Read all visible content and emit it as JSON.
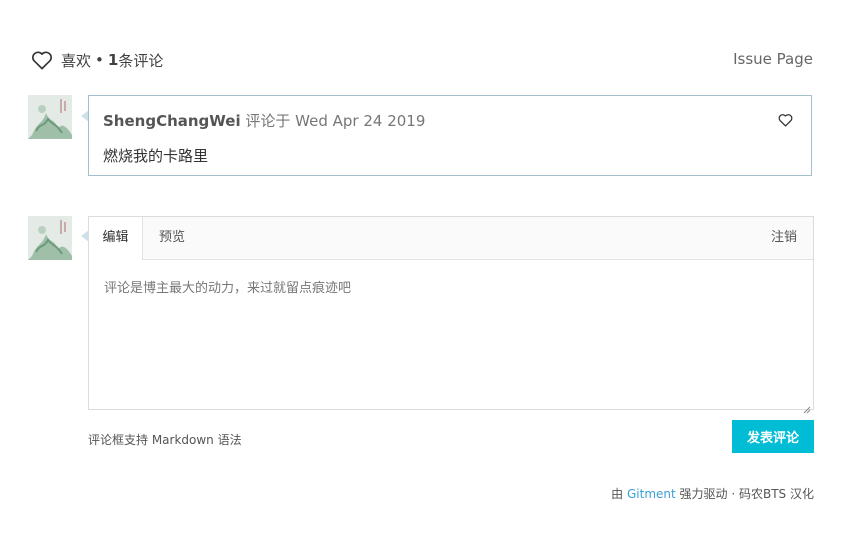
{
  "header": {
    "like_label": "喜欢",
    "separator": "•",
    "comment_count": "1",
    "comment_unit": "条评论",
    "issue_page": "Issue Page"
  },
  "comments": [
    {
      "author": "ShengChangWei",
      "meta": "评论于 Wed Apr 24 2019",
      "body": "燃烧我的卡路里"
    }
  ],
  "editor": {
    "tab_edit": "编辑",
    "tab_preview": "预览",
    "logout": "注销",
    "placeholder": "评论是博主最大的动力，来过就留点痕迹吧"
  },
  "hint": "评论框支持 Markdown 语法",
  "submit_label": "发表评论",
  "footer": {
    "prefix": "由",
    "link": "Gitment",
    "suffix": "强力驱动 · 码农BTS 汉化"
  },
  "colors": {
    "accent": "#00bcd4",
    "link": "#3a9fd6",
    "comment_border": "#a3bfcc"
  },
  "icons": [
    "heart-icon",
    "heart-outline-icon",
    "resize-grip-icon"
  ]
}
